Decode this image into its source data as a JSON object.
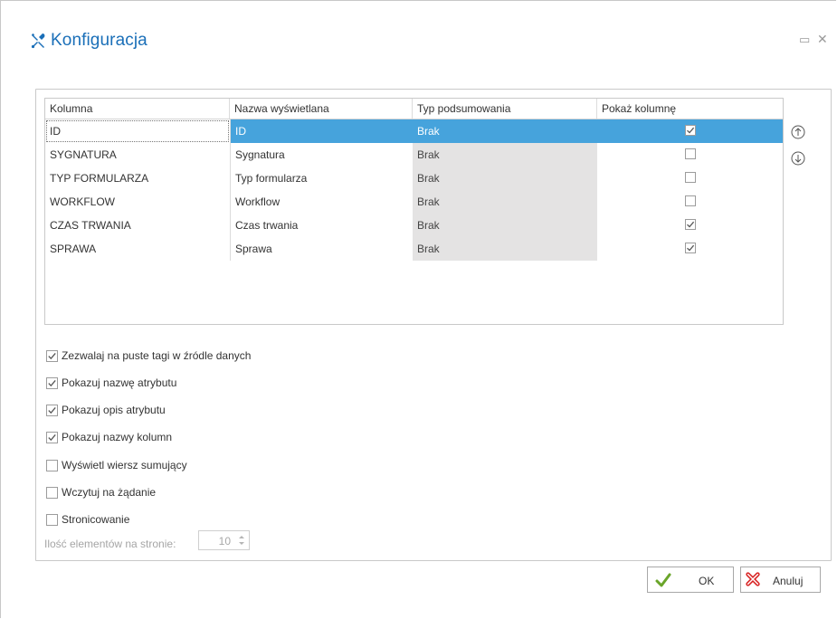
{
  "dialog": {
    "title": "Konfiguracja",
    "title_icon": "tools-icon",
    "accent_color": "#1a6fb8",
    "selection_color": "#46a3dc"
  },
  "grid": {
    "headers": [
      "Kolumna",
      "Nazwa wyświetlana",
      "Typ podsumowania",
      "Pokaż kolumnę"
    ],
    "rows": [
      {
        "column": "ID",
        "display_name": "ID",
        "summary": "Brak",
        "show": true,
        "selected": true
      },
      {
        "column": "SYGNATURA",
        "display_name": "Sygnatura",
        "summary": "Brak",
        "show": false,
        "selected": false
      },
      {
        "column": "TYP FORMULARZA",
        "display_name": "Typ formularza",
        "summary": "Brak",
        "show": false,
        "selected": false
      },
      {
        "column": "WORKFLOW",
        "display_name": "Workflow",
        "summary": "Brak",
        "show": false,
        "selected": false
      },
      {
        "column": "CZAS TRWANIA",
        "display_name": "Czas trwania",
        "summary": "Brak",
        "show": true,
        "selected": false
      },
      {
        "column": "SPRAWA",
        "display_name": "Sprawa",
        "summary": "Brak",
        "show": true,
        "selected": false
      }
    ]
  },
  "options": [
    {
      "label": "Zezwalaj na puste tagi w źródle danych",
      "checked": true
    },
    {
      "label": "Pokazuj nazwę atrybutu",
      "checked": true
    },
    {
      "label": "Pokazuj opis atrybutu",
      "checked": true
    },
    {
      "label": "Pokazuj nazwy kolumn",
      "checked": true
    },
    {
      "label": "Wyświetl wiersz sumujący",
      "checked": false
    },
    {
      "label": "Wczytuj na żądanie",
      "checked": false
    },
    {
      "label": "Stronicowanie",
      "checked": false
    }
  ],
  "paging": {
    "label": "Ilość elementów na stronie:",
    "value": "10"
  },
  "buttons": {
    "ok": "OK",
    "cancel": "Anuluj"
  }
}
